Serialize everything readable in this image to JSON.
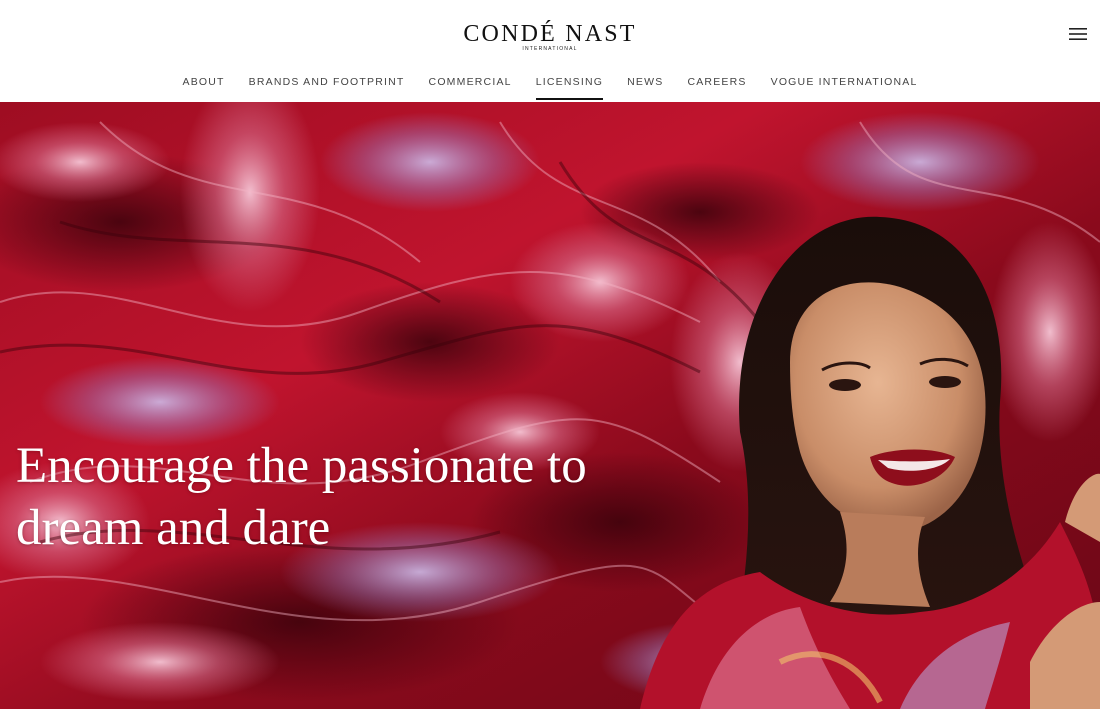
{
  "brand": {
    "name": "CONDÉ NAST",
    "tagline": "INTERNATIONAL"
  },
  "header": {
    "menu_icon": "hamburger-menu-icon"
  },
  "nav": {
    "active": "LICENSING",
    "items": [
      {
        "label": "ABOUT"
      },
      {
        "label": "BRANDS AND FOOTPRINT"
      },
      {
        "label": "COMMERCIAL"
      },
      {
        "label": "LICENSING"
      },
      {
        "label": "NEWS"
      },
      {
        "label": "CAREERS"
      },
      {
        "label": "VOGUE INTERNATIONAL"
      }
    ]
  },
  "hero": {
    "headline_line1": "Encourage the passionate to",
    "headline_line2": "dream and dare",
    "colors": {
      "foil_red": "#b3112b",
      "foil_dark": "#5a0613",
      "foil_pink": "#e58aa8",
      "foil_lilac": "#b7a2d6"
    }
  }
}
